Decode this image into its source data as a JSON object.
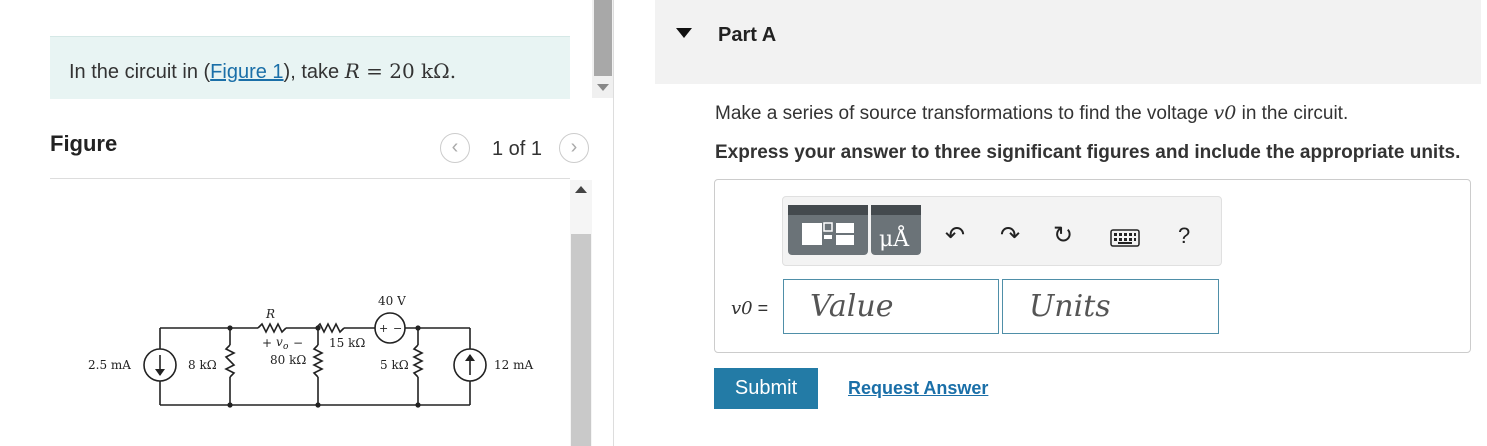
{
  "problem": {
    "intro_text_before": "In the circuit in (",
    "figure_link": "Figure 1",
    "intro_text_after": "), take ",
    "variable": "R",
    "equals_value": " = 20 kΩ."
  },
  "figure": {
    "title": "Figure",
    "pager_text": "1 of 1",
    "prev_icon": "chevron-left-icon",
    "next_icon": "chevron-right-icon",
    "circuit_labels": {
      "source_left": "2.5 mA",
      "r1": "8 kΩ",
      "r_label": "R",
      "vo_plus": "+",
      "vo_symbol": "v",
      "vo_sub": "o",
      "vo_minus": "−",
      "r2": "80 kΩ",
      "r3": "15 kΩ",
      "vsource": "40 V",
      "vsource_plus": "+",
      "vsource_minus": "−",
      "r4": "5 kΩ",
      "source_right": "12 mA"
    }
  },
  "part": {
    "title": "Part A",
    "question_before": "Make a series of source transformations to find the voltage ",
    "question_var": "v0",
    "question_after": " in the circuit.",
    "instruction": "Express your answer to three significant figures and include the appropriate units."
  },
  "toolbar": {
    "templates_icon": "templates-icon",
    "units_button_text": "μÅ",
    "undo_icon": "undo-icon",
    "redo_icon": "redo-icon",
    "reset_icon": "reset-icon",
    "keyboard_icon": "keyboard-icon",
    "help_text": "?"
  },
  "answer": {
    "variable_label": "v0",
    "equals": " =",
    "value_placeholder": "Value",
    "units_placeholder": "Units"
  },
  "actions": {
    "submit_label": "Submit",
    "request_label": "Request Answer"
  }
}
